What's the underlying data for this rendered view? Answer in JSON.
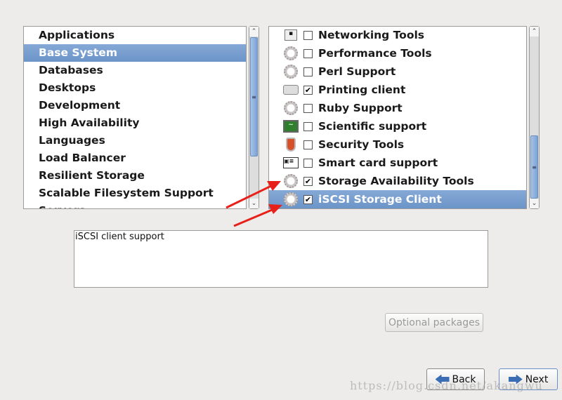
{
  "groups": [
    "Applications",
    "Base System",
    "Databases",
    "Desktops",
    "Development",
    "High Availability",
    "Languages",
    "Load Balancer",
    "Resilient Storage",
    "Scalable Filesystem Support",
    "Servers"
  ],
  "selected_group": "Base System",
  "packages": [
    {
      "label": "Networking Tools",
      "checked": false,
      "icon": "network-icon"
    },
    {
      "label": "Performance Tools",
      "checked": false,
      "icon": "gear-icon"
    },
    {
      "label": "Perl Support",
      "checked": false,
      "icon": "gear-icon"
    },
    {
      "label": "Printing client",
      "checked": true,
      "icon": "printer-icon"
    },
    {
      "label": "Ruby Support",
      "checked": false,
      "icon": "gear-icon"
    },
    {
      "label": "Scientific support",
      "checked": false,
      "icon": "monitor-icon"
    },
    {
      "label": "Security Tools",
      "checked": false,
      "icon": "shield-icon"
    },
    {
      "label": "Smart card support",
      "checked": false,
      "icon": "id-card-icon"
    },
    {
      "label": "Storage Availability Tools",
      "checked": true,
      "icon": "gear-icon"
    },
    {
      "label": "iSCSI Storage Client",
      "checked": true,
      "icon": "gear-icon"
    }
  ],
  "selected_package": "iSCSI Storage Client",
  "description": "iSCSI client support",
  "buttons": {
    "optional": "Optional packages",
    "back": "Back",
    "next": "Next"
  },
  "watermark": "https://blog.csdn.net/akangwu",
  "colors": {
    "selection": "#7099cc",
    "annotation_arrow": "#e8201a"
  }
}
